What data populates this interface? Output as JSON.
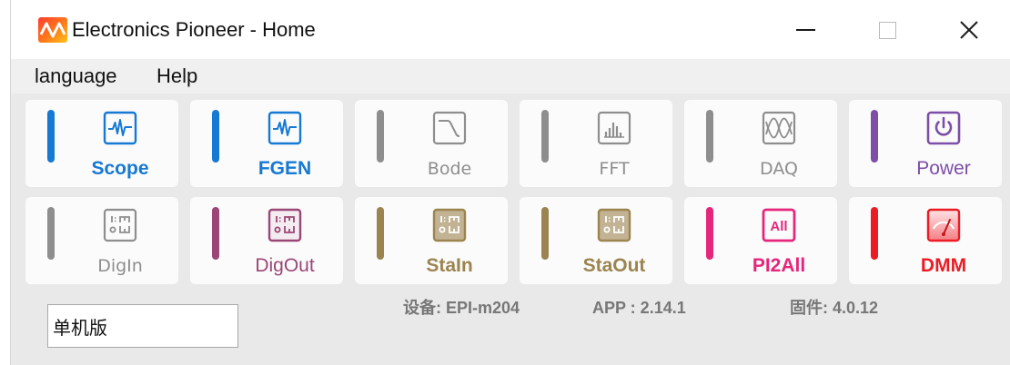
{
  "window": {
    "title": "Electronics Pioneer - Home",
    "icon": "app-waveform-icon",
    "controls": [
      "minimize-icon",
      "maximize-icon",
      "close-icon"
    ]
  },
  "menu": {
    "items": [
      {
        "label": "language"
      },
      {
        "label": "Help"
      }
    ]
  },
  "tiles": [
    {
      "label": "Scope",
      "icon": "oscilloscope-icon",
      "color": "#1679d4"
    },
    {
      "label": "FGEN",
      "icon": "function-generator-icon",
      "color": "#1679d4"
    },
    {
      "label": "Bode",
      "icon": "bode-plot-icon",
      "color": "#8e8e8e"
    },
    {
      "label": "FFT",
      "icon": "spectrum-bars-icon",
      "color": "#8e8e8e"
    },
    {
      "label": "DAQ",
      "icon": "data-acquisition-icon",
      "color": "#8e8e8e"
    },
    {
      "label": "Power",
      "icon": "power-icon",
      "color": "#7d4fa8"
    },
    {
      "label": "DigIn",
      "icon": "digital-in-icon",
      "color": "#8e8e8e"
    },
    {
      "label": "DigOut",
      "icon": "digital-out-icon",
      "color": "#9b4676"
    },
    {
      "label": "StaIn",
      "icon": "static-in-icon",
      "color": "#9c8450"
    },
    {
      "label": "StaOut",
      "icon": "static-out-icon",
      "color": "#9c8450"
    },
    {
      "label": "PI2All",
      "icon": "pi2all-icon",
      "icon_text": "All",
      "color": "#e5267b"
    },
    {
      "label": "DMM",
      "icon": "multimeter-icon",
      "color": "#ec1c24"
    }
  ],
  "footer": {
    "mode": "单机版",
    "device": "设备: EPI-m204",
    "app_version": "APP : 2.14.1",
    "firmware": "固件: 4.0.12"
  }
}
